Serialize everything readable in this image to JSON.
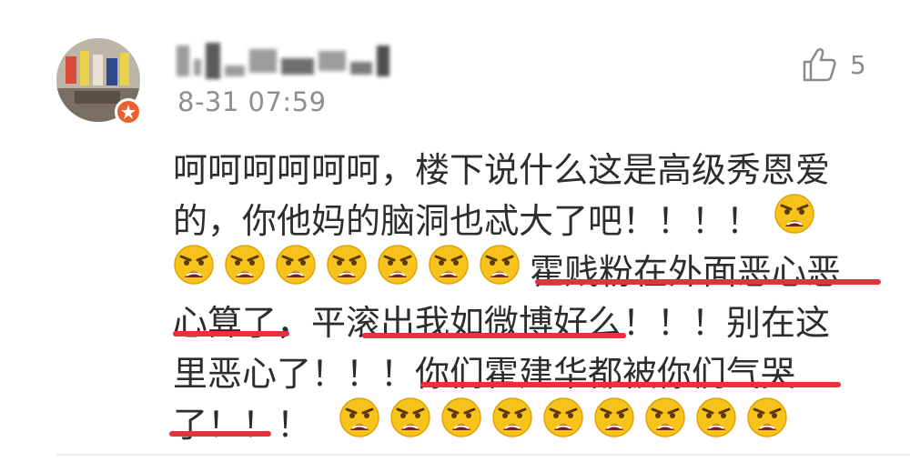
{
  "comment": {
    "timestamp": "8-31 07:59",
    "like_count": "5",
    "lines": [
      {
        "text": "呵呵呵呵呵呵，楼下说什么这是高级秀恩爱"
      },
      {
        "text": "的，你他妈的脑洞也忒大了吧！！！！"
      },
      {
        "text": "霍贱粉在外面恶心恶"
      },
      {
        "text": "心算了，平滚出我如微博好么！！！别在这"
      },
      {
        "text": "里恶心了！！！你们霍建华都被你们气哭"
      },
      {
        "text": "了！！！"
      }
    ],
    "emoji": "angry-face-icon"
  },
  "colors": {
    "text": "#2d2d2d",
    "meta": "#8f8f8f",
    "underline": "#ea2f3c",
    "badge": "#e8602a",
    "emoji_face": "#f7c21b"
  }
}
